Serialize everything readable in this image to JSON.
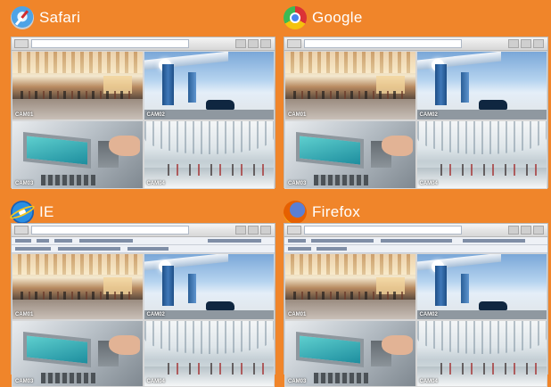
{
  "quadrants": [
    {
      "browser": "Safari",
      "icon": "safari-logo-icon",
      "cameras": [
        "CAM01",
        "CAM02",
        "CAM03",
        "CAM04"
      ]
    },
    {
      "browser": "Google",
      "icon": "chrome-logo-icon",
      "cameras": [
        "CAM01",
        "CAM02",
        "CAM03",
        "CAM04"
      ]
    },
    {
      "browser": "IE",
      "icon": "ie-logo-icon",
      "cameras": [
        "CAM01",
        "CAM02",
        "CAM03",
        "CAM04"
      ]
    },
    {
      "browser": "Firefox",
      "icon": "firefox-logo-icon",
      "cameras": [
        "CAM01",
        "CAM02",
        "CAM03",
        "CAM04"
      ]
    }
  ],
  "colors": {
    "background": "#f0852a",
    "label": "#ffffff"
  }
}
